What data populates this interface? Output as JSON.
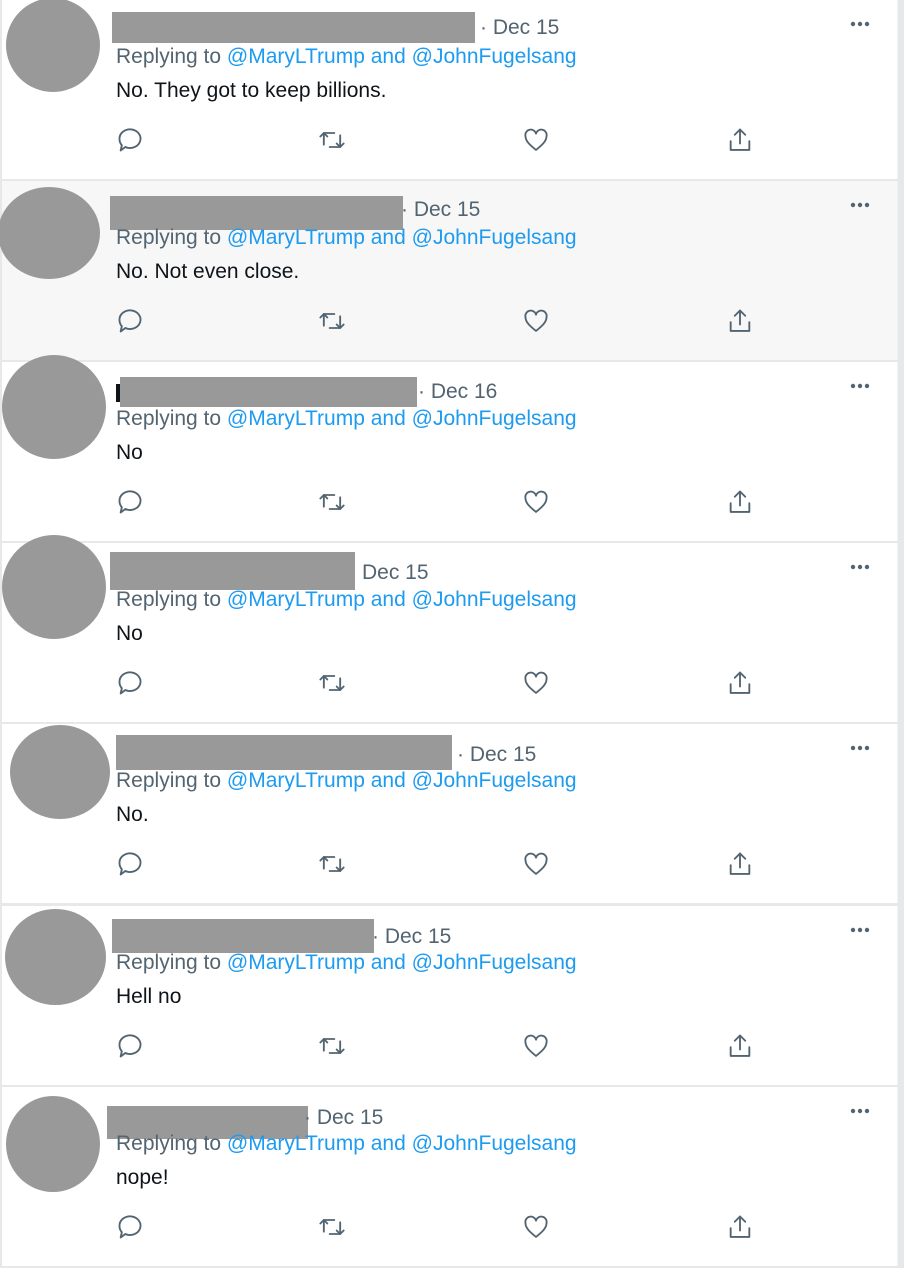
{
  "reply_prefix": "Replying to",
  "mention_1": "@MaryLTrump",
  "mention_joiner": "and",
  "mention_2": "@JohnFugelsang",
  "colors": {
    "text": "#0f1419",
    "secondary": "#536471",
    "link": "#1d9bf0",
    "redaction": "#999999",
    "hover_bg": "#f7f7f7"
  },
  "icons": [
    "reply-icon",
    "retweet-icon",
    "like-icon",
    "share-icon",
    "more-options-icon"
  ],
  "tweets": [
    {
      "date": "· Dec 15",
      "text": "No. They got to keep billions."
    },
    {
      "date": "· Dec 15",
      "text": "No. Not even close."
    },
    {
      "date": "· Dec 16",
      "text": "No"
    },
    {
      "date": "Dec 15",
      "text": "No"
    },
    {
      "date": "· Dec 15",
      "text": "No."
    },
    {
      "date": "· Dec 15",
      "text": "Hell no"
    },
    {
      "date": "· Dec 15",
      "text": "nope!"
    }
  ]
}
